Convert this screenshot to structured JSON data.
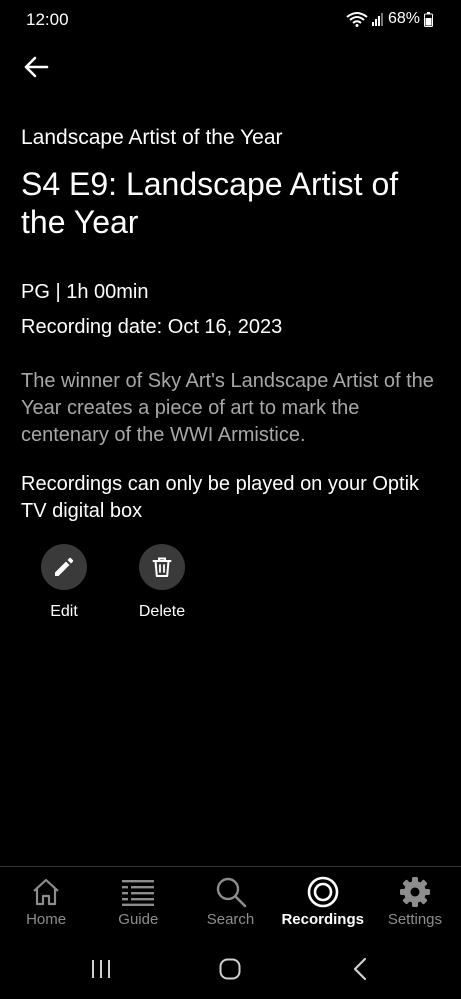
{
  "status_bar": {
    "time": "12:00",
    "battery": "68%",
    "icons": [
      "wifi-icon",
      "signal-icon",
      "battery-icon"
    ]
  },
  "header": {
    "back_icon": "arrow-left-icon"
  },
  "program": {
    "show_name": "Landscape Artist of the Year",
    "episode_title": "S4 E9: Landscape Artist of the Year",
    "rating_duration": "PG | 1h 00min",
    "recording_date": "Recording date: Oct 16, 2023",
    "description": "The winner of Sky Art's Landscape Artist of the Year creates a piece of art to mark the centenary of the WWI Armistice.",
    "notice": "Recordings can only be played on your Optik TV digital box"
  },
  "actions": {
    "edit_label": "Edit",
    "delete_label": "Delete"
  },
  "bottom_nav": {
    "items": [
      {
        "label": "Home",
        "icon": "home-icon"
      },
      {
        "label": "Guide",
        "icon": "guide-icon"
      },
      {
        "label": "Search",
        "icon": "search-icon"
      },
      {
        "label": "Recordings",
        "icon": "recordings-icon",
        "active": true
      },
      {
        "label": "Settings",
        "icon": "gear-icon"
      }
    ]
  },
  "colors": {
    "background": "#000000",
    "text": "#ffffff",
    "muted_text": "#a7a7a7",
    "nav_inactive": "#8d8d8d",
    "action_circle": "#3a3a3a"
  }
}
